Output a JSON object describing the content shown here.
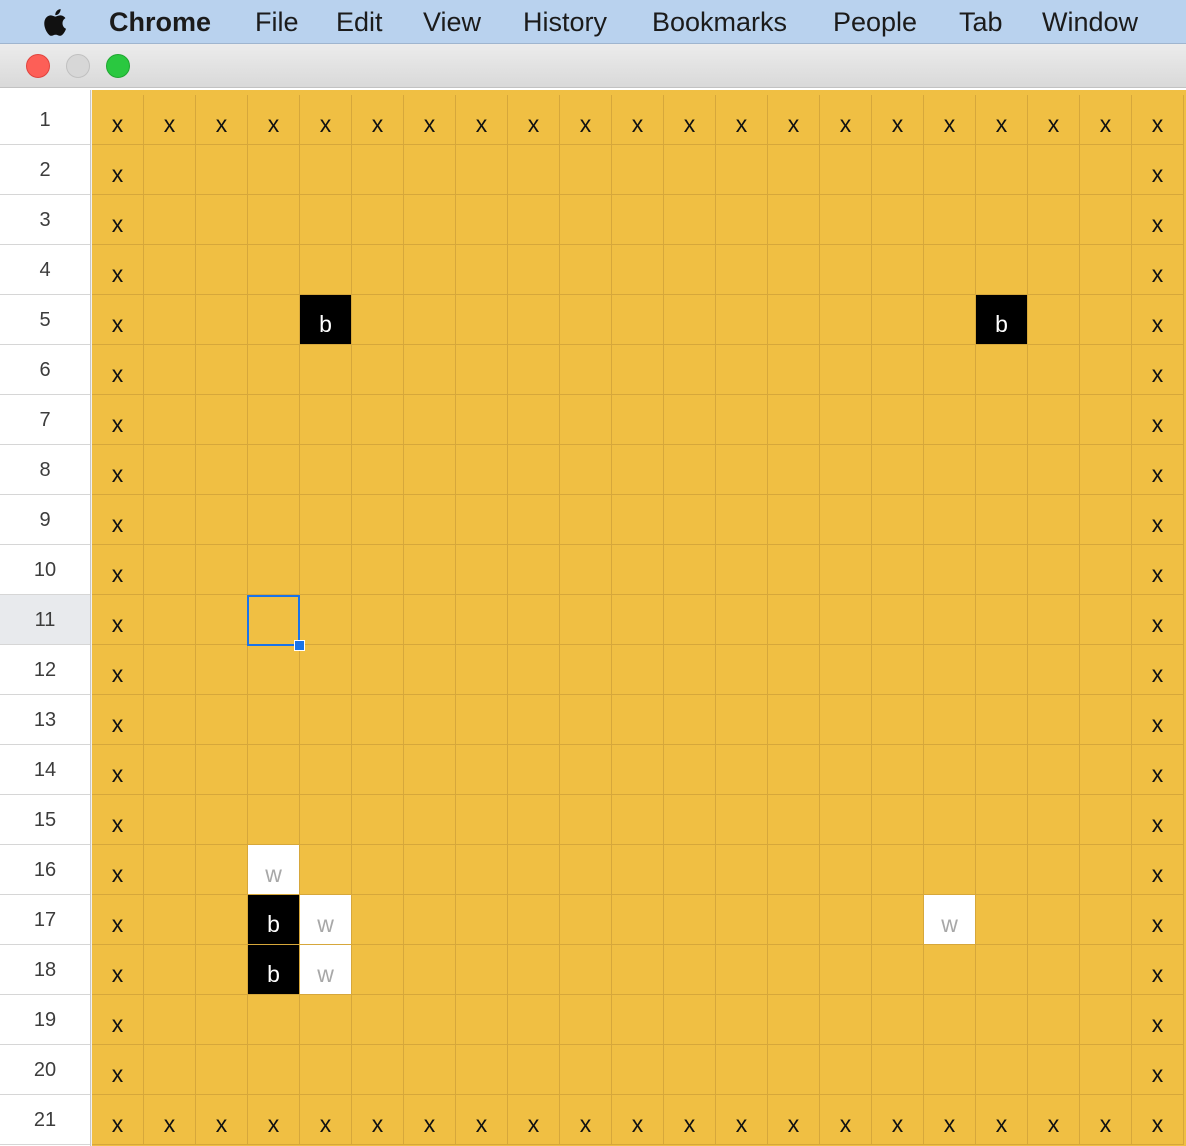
{
  "menubar": {
    "apple_icon": "apple-logo-icon",
    "items": [
      {
        "label": "Chrome",
        "bold": true
      },
      {
        "label": "File"
      },
      {
        "label": "Edit"
      },
      {
        "label": "View"
      },
      {
        "label": "History"
      },
      {
        "label": "Bookmarks"
      },
      {
        "label": "People"
      },
      {
        "label": "Tab"
      },
      {
        "label": "Window"
      }
    ]
  },
  "window": {
    "buttons": [
      {
        "name": "close-button",
        "color": "#fd5f57"
      },
      {
        "name": "minimize-button",
        "color": "#d7d7d7"
      },
      {
        "name": "zoom-button",
        "color": "#2ac840"
      }
    ]
  },
  "sheet": {
    "colors": {
      "board": "#f0bf43",
      "black_stone": "#000000",
      "white_stone": "#ffffff",
      "selection": "#1a73e8"
    },
    "row_numbers": [
      "1",
      "2",
      "3",
      "4",
      "5",
      "6",
      "7",
      "8",
      "9",
      "10",
      "11",
      "12",
      "13",
      "14",
      "15",
      "16",
      "17",
      "18",
      "19",
      "20",
      "21"
    ],
    "active_row": "11",
    "cells": [
      "x x x x x x x x x x x x x x x x x x x x x",
      "x . . . . . . . . . . . . . . . . . . . x",
      "x . . . . . . . . . . . . . . . . . . . x",
      "x . . . . . . . . . . . . . . . . . . . x",
      "x . . . b . . . . . . . . . . . . b . . x",
      "x . . . . . . . . . . . . . . . . . . . x",
      "x . . . . . . . . . . . . . . . . . . . x",
      "x . . . . . . . . . . . . . . . . . . . x",
      "x . . . . . . . . . . . . . . . . . . . x",
      "x . . . . . . . . . . . . . . . . . . . x",
      "x . . . . . . . . . . . . . . . . . . . x",
      "x . . . . . . . . . . . . . . . . . . . x",
      "x . . . . . . . . . . . . . . . . . . . x",
      "x . . . . . . . . . . . . . . . . . . . x",
      "x . . . . . . . . . . . . . . . . . . . x",
      "x . . w . . . . . . . . . . . . . . . . x",
      "x . . b w . . . . . . . . . . . w . . . x",
      "x . . b w . . . . . . . . . . . . . . . x",
      "x . . . . . . . . . . . . . . . . . . . x",
      "x . . . . . . . . . . . . . . . . . . . x",
      "x x x x x x x x x x x x x x x x x x x x x"
    ],
    "selected_cell": {
      "row": "11",
      "column_index": 3
    }
  }
}
